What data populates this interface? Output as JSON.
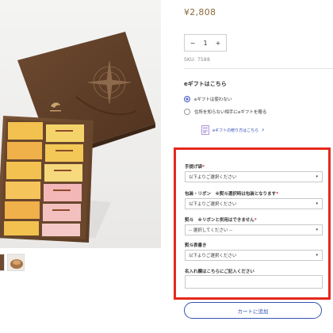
{
  "product": {
    "price": "¥2,808",
    "quantity": "1",
    "qty_minus": "−",
    "qty_plus": "+",
    "sku": "SKU: 7588",
    "gallery_image_alt": "gift box"
  },
  "egift": {
    "heading": "eギフトはこちら",
    "options": [
      {
        "label": "eギフトは使わない",
        "selected": true
      },
      {
        "label": "住所を知らない相手にeギフトを贈る",
        "selected": false
      }
    ],
    "howto_label": "eギフトの贈り方はこちら",
    "howto_icon": "e-gift-icon",
    "howto_chevron": "›"
  },
  "options_form": {
    "fields": [
      {
        "label": "手提げ袋",
        "required": "*",
        "value": "以下よりご選択ください"
      },
      {
        "label": "包装・リボン　※熨斗選択時は包装となります",
        "required": "*",
        "value": "以下よりご選択ください"
      },
      {
        "label": "熨斗　※リボンと併用はできません",
        "required": "*",
        "value": "-- 選択してください --"
      },
      {
        "label": "熨斗表書き",
        "required": "",
        "value": "以下よりご選択ください"
      }
    ],
    "name_field_label": "名入れ欄はこちらにご記入ください",
    "name_field_value": "",
    "caret_icon": "▾"
  },
  "actions": {
    "add_to_cart": "カートに追加"
  },
  "colors": {
    "highlight_border": "#e4281c",
    "accent_blue": "#3453b5",
    "price_color": "#8a6a3c",
    "required_mark": "#d52b2b"
  }
}
